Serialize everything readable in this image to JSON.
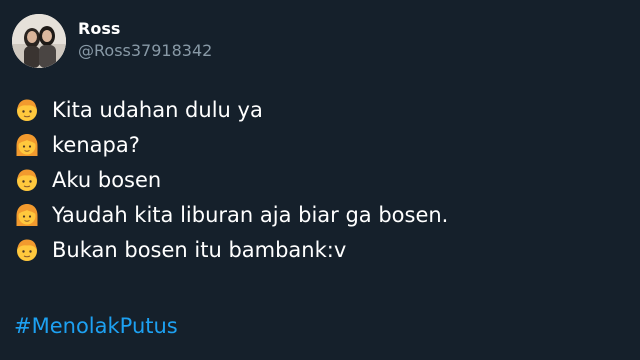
{
  "tweet": {
    "display_name": "Ross",
    "handle": "@Ross37918342",
    "lines": [
      {
        "speaker_icon": "boy-emoji-icon",
        "text": "Kita udahan dulu ya"
      },
      {
        "speaker_icon": "girl-emoji-icon",
        "text": "kenapa?"
      },
      {
        "speaker_icon": "boy-emoji-icon",
        "text": "Aku bosen"
      },
      {
        "speaker_icon": "girl-emoji-icon",
        "text": "Yaudah kita liburan aja biar ga bosen."
      },
      {
        "speaker_icon": "boy-emoji-icon",
        "text": "Bukan bosen itu bambank:v"
      }
    ],
    "hashtag": "#MenolakPutus"
  },
  "colors": {
    "background": "#15202b",
    "text": "#ffffff",
    "muted": "#8899a6",
    "link": "#1da1f2"
  }
}
